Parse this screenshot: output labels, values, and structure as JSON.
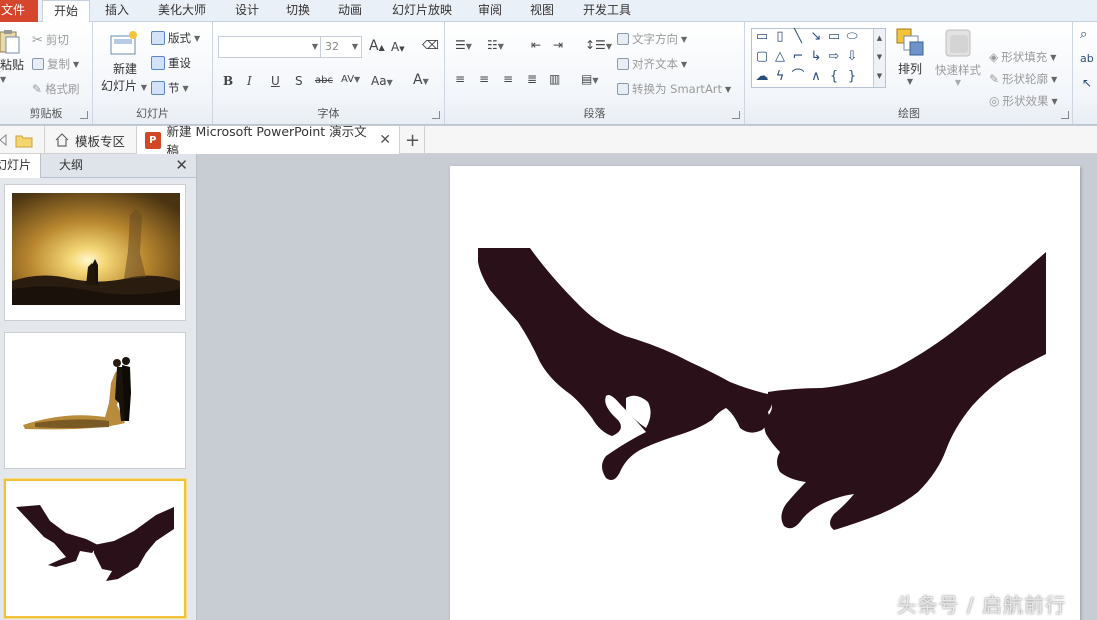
{
  "menu": {
    "file": "文件",
    "tabs": [
      "开始",
      "插入",
      "美化大师",
      "设计",
      "切换",
      "动画",
      "幻灯片放映",
      "审阅",
      "视图",
      "开发工具"
    ],
    "active": "开始"
  },
  "ribbon": {
    "clipboard": {
      "paste": "粘贴",
      "cut": "剪切",
      "copy": "复制",
      "format_painter": "格式刷",
      "label": "剪贴板"
    },
    "slides": {
      "new_slide_line1": "新建",
      "new_slide_line2": "幻灯片",
      "layout": "版式",
      "reset": "重设",
      "section": "节",
      "label": "幻灯片"
    },
    "font": {
      "font_name": "",
      "font_size": "32",
      "label": "字体"
    },
    "paragraph": {
      "text_direction": "文字方向",
      "align_text": "对齐文本",
      "convert_smartart": "转换为 SmartArt",
      "label": "段落"
    },
    "drawing": {
      "arrange": "排列",
      "quick_styles": "快速样式",
      "shape_fill": "形状填充",
      "shape_outline": "形状轮廓",
      "shape_effects": "形状效果",
      "label": "绘图"
    }
  },
  "doctabs": {
    "templates": "模板专区",
    "document": "新建 Microsoft PowerPoint 演示文稿",
    "ppt_icon_letter": "P"
  },
  "leftpane": {
    "tab_slides": "幻灯片",
    "tab_outline": "大纲",
    "close": "✕"
  },
  "slide": {
    "watermark": "头条号 / 启航前行"
  },
  "colors": {
    "accent": "#d6462c",
    "selection": "#f0c23c",
    "silhouette": "#2a1018"
  }
}
